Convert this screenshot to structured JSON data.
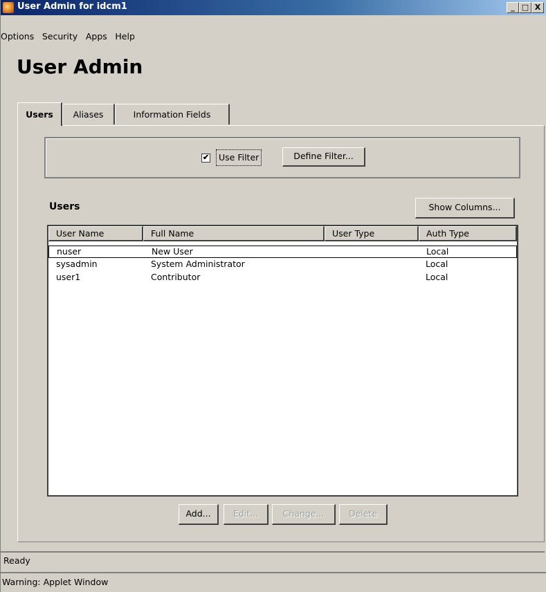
{
  "window": {
    "title": "User Admin for idcm1",
    "minimize_label": "_",
    "maximize_label": "□",
    "close_label": "X"
  },
  "menu": [
    "Options",
    "Security",
    "Apps",
    "Help"
  ],
  "heading": "User Admin",
  "tabs": [
    {
      "label": "Users",
      "active": true
    },
    {
      "label": "Aliases",
      "active": false
    },
    {
      "label": "Information Fields",
      "active": false
    }
  ],
  "filter": {
    "checkbox_checked": true,
    "checkbox_mark": "✔",
    "use_filter_label": "Use Filter",
    "define_filter_label": "Define Filter..."
  },
  "users_section": {
    "title": "Users",
    "show_columns_label": "Show Columns..."
  },
  "table": {
    "columns": [
      "User Name",
      "Full Name",
      "User Type",
      "Auth Type"
    ],
    "rows": [
      {
        "user_name": "nuser",
        "full_name": "New User",
        "user_type": "",
        "auth_type": "Local",
        "selected": true
      },
      {
        "user_name": "sysadmin",
        "full_name": "System Administrator",
        "user_type": "",
        "auth_type": "Local",
        "selected": false
      },
      {
        "user_name": "user1",
        "full_name": "Contributor",
        "user_type": "",
        "auth_type": "Local",
        "selected": false
      }
    ]
  },
  "actions": {
    "add": "Add...",
    "edit": "Edit...",
    "change": "Change...",
    "delete": "Delete"
  },
  "status": "Ready",
  "warning": "Warning: Applet Window",
  "colors": {
    "titlebar_start": "#0a246a",
    "titlebar_end": "#a6caf0",
    "face": "#d4d0c8"
  }
}
